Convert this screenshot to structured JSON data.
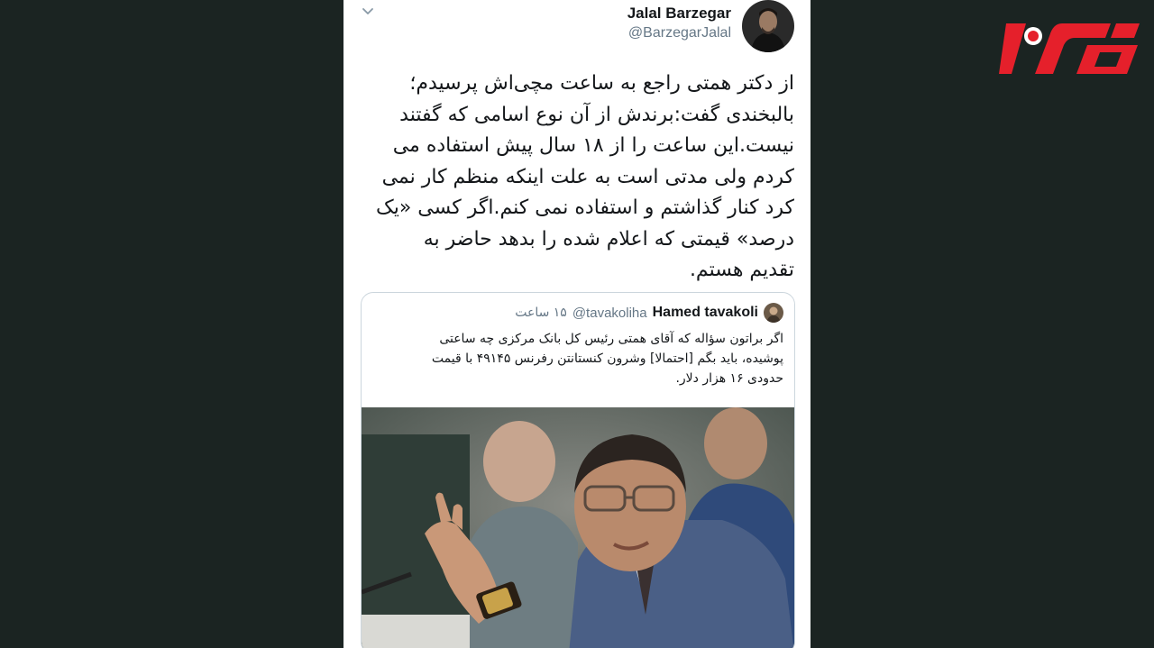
{
  "tweet": {
    "author_name": "Jalal Barzegar",
    "author_handle": "@BarzegarJalal",
    "text": "از دکتر همتی راجع به ساعت مچی‌اش پرسیدم؛\nبالبخندی گفت:برندش از آن نوع اسامی که گفتند\nنیست.این ساعت را از ۱۸ سال پیش استفاده می\nکردم ولی مدتی است به علت اینکه منظم کار نمی\nکرد کنار گذاشتم و استفاده نمی کنم.اگر کسی «یک\nدرصد» قیمتی که اعلام شده را بدهد حاضر به\nتقدیم هستم.",
    "menu_icon": "chevron-down-icon"
  },
  "quoted_tweet": {
    "author_name": "Hamed tavakoli",
    "author_handle": "@tavakoliha",
    "time": "۱۵ ساعت",
    "text": "اگر براتون سؤاله که آقای همتی رئیس کل بانک مرکزی چه ساعتی\nپوشیده، باید بگم [احتمالا] وشرون کنستانتن رفرنس ۴۹۱۴۵ با قیمت\nحدودی ۱۶ هزار دلار."
  },
  "colors": {
    "background": "#1b2422",
    "card": "#ffffff",
    "text": "#14171a",
    "secondary_text": "#657786",
    "logo_red": "#e5202b"
  }
}
